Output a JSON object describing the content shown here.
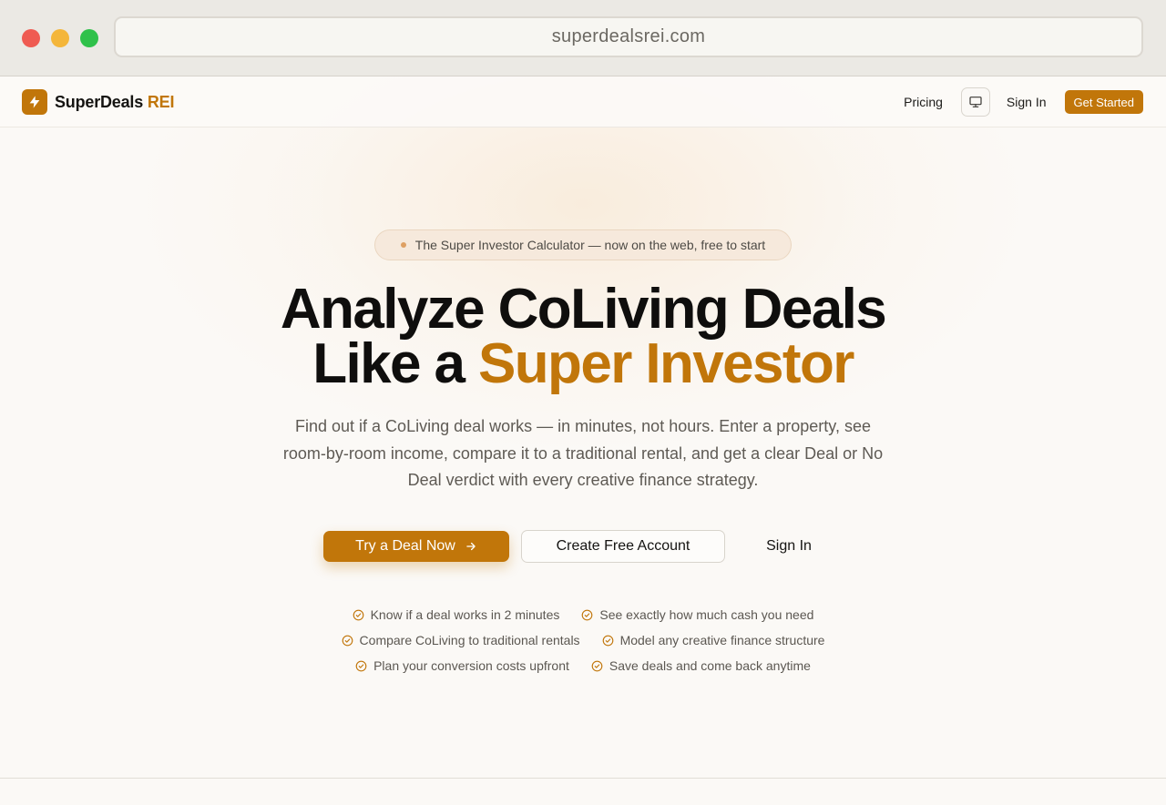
{
  "browser": {
    "url": "superdealsrei.com"
  },
  "nav": {
    "brand_name": "SuperDeals",
    "brand_accent": "REI",
    "pricing": "Pricing",
    "sign_in": "Sign In",
    "get_started": "Get Started"
  },
  "hero": {
    "pill_text": "The Super Investor Calculator — now on the web, free to start",
    "headline_line1": "Analyze CoLiving Deals",
    "headline_line2_prefix": "Like a ",
    "headline_line2_accent": "Super Investor",
    "subheadline": "Find out if a CoLiving deal works — in minutes, not hours. Enter a property, see room-by-room income, compare it to a traditional rental, and get a clear Deal or No Deal verdict with every creative finance strategy."
  },
  "cta": {
    "primary": "Try a Deal Now",
    "secondary": "Create Free Account",
    "ghost": "Sign In"
  },
  "features": [
    "Know if a deal works in 2 minutes",
    "See exactly how much cash you need",
    "Compare CoLiving to traditional rentals",
    "Model any creative finance structure",
    "Plan your conversion costs upfront",
    "Save deals and come back anytime"
  ],
  "colors": {
    "accent": "#c1760a",
    "text": "#0f0e0d",
    "muted": "#5e5a54",
    "page_bg": "#fbf9f6"
  },
  "icons": {
    "brand": "lightning-bolt-icon",
    "theme": "monitor-icon",
    "arrow": "arrow-right-icon",
    "feature": "check-circle-icon"
  }
}
